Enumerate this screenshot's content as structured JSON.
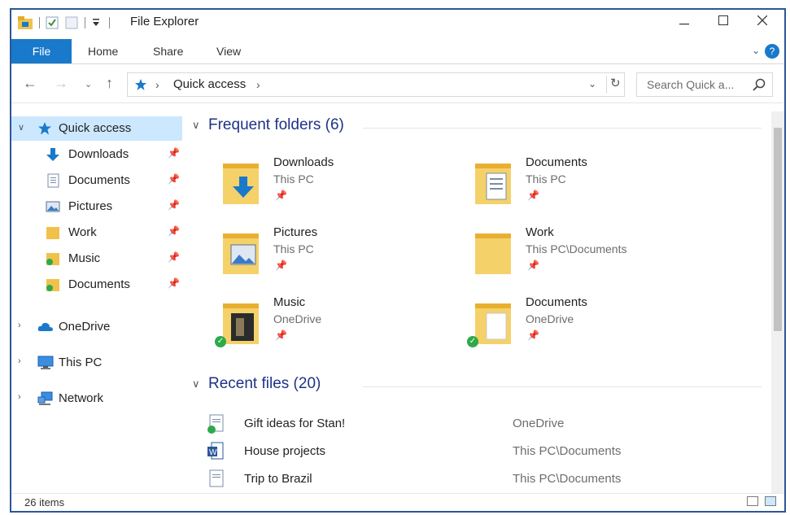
{
  "window": {
    "title": "File Explorer"
  },
  "ribbon": {
    "tabs": [
      {
        "label": "File"
      },
      {
        "label": "Home"
      },
      {
        "label": "Share"
      },
      {
        "label": "View"
      }
    ],
    "help": "?"
  },
  "address": {
    "breadcrumb": [
      "Quick access"
    ],
    "search_placeholder": "Search Quick a..."
  },
  "nav_pane": {
    "quick_access": {
      "label": "Quick access",
      "items": [
        {
          "label": "Downloads",
          "icon": "download-icon"
        },
        {
          "label": "Documents",
          "icon": "document-icon"
        },
        {
          "label": "Pictures",
          "icon": "pictures-icon"
        },
        {
          "label": "Work",
          "icon": "folder-icon"
        },
        {
          "label": "Music",
          "icon": "folder-icon"
        },
        {
          "label": "Documents",
          "icon": "folder-icon"
        }
      ]
    },
    "roots": [
      {
        "label": "OneDrive",
        "icon": "cloud-icon"
      },
      {
        "label": "This PC",
        "icon": "computer-icon"
      },
      {
        "label": "Network",
        "icon": "network-icon"
      }
    ]
  },
  "content": {
    "frequent": {
      "title": "Frequent folders (6)",
      "folders": [
        {
          "name": "Downloads",
          "location": "This PC",
          "icon": "download-folder-icon"
        },
        {
          "name": "Documents",
          "location": "This PC",
          "icon": "documents-folder-icon"
        },
        {
          "name": "Pictures",
          "location": "This PC",
          "icon": "pictures-folder-icon"
        },
        {
          "name": "Work",
          "location": "This PC\\Documents",
          "icon": "folder-icon"
        },
        {
          "name": "Music",
          "location": "OneDrive",
          "icon": "music-folder-icon"
        },
        {
          "name": "Documents",
          "location": "OneDrive",
          "icon": "documents-folder-icon"
        }
      ]
    },
    "recent": {
      "title": "Recent files (20)",
      "files": [
        {
          "name": "Gift ideas for Stan!",
          "location": "OneDrive",
          "icon": "text-file-icon"
        },
        {
          "name": "House projects",
          "location": "This PC\\Documents",
          "icon": "word-file-icon"
        },
        {
          "name": "Trip to Brazil",
          "location": "This PC\\Documents",
          "icon": "text-file-icon"
        }
      ]
    }
  },
  "status": {
    "count": "26 items"
  },
  "colors": {
    "accent": "#1979ca",
    "selected": "#cce8ff",
    "group_heading": "#1e3287",
    "folder": "#f0c24c"
  }
}
